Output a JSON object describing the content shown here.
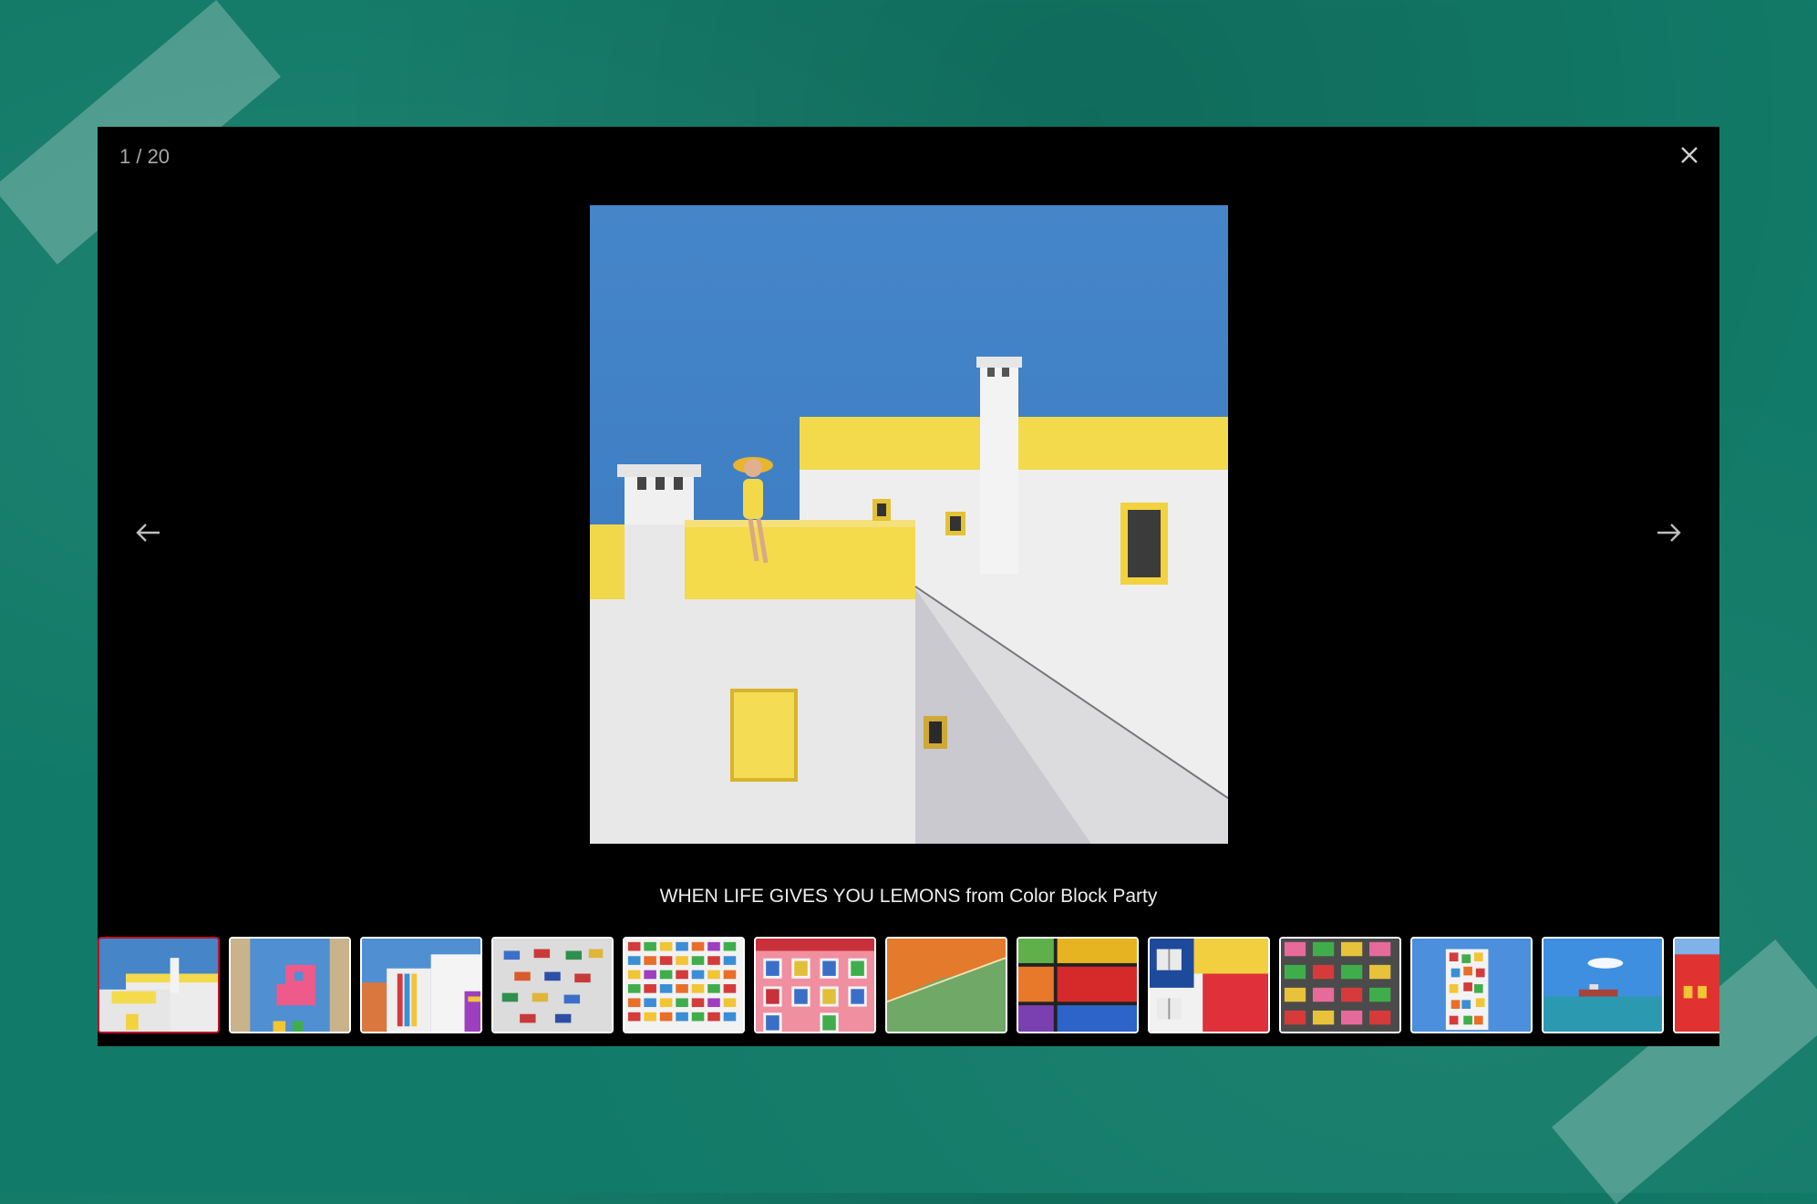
{
  "lightbox": {
    "counter": "1 / 20",
    "caption": "WHEN LIFE GIVES YOU LEMONS from Color Block Party",
    "close_icon": "close-icon",
    "prev_icon": "arrow-left-icon",
    "next_icon": "arrow-right-icon"
  },
  "colors": {
    "background": "#127a68",
    "lightbox_bg": "#000000",
    "active_thumb_border": "#c0102a",
    "sky": "#3f7fc6",
    "yellow": "#f3dc4a"
  },
  "thumbnails": [
    {
      "index": 1,
      "active": true
    },
    {
      "index": 2,
      "active": false
    },
    {
      "index": 3,
      "active": false
    },
    {
      "index": 4,
      "active": false
    },
    {
      "index": 5,
      "active": false
    },
    {
      "index": 6,
      "active": false
    },
    {
      "index": 7,
      "active": false
    },
    {
      "index": 8,
      "active": false
    },
    {
      "index": 9,
      "active": false
    },
    {
      "index": 10,
      "active": false
    },
    {
      "index": 11,
      "active": false
    },
    {
      "index": 12,
      "active": false
    },
    {
      "index": 13,
      "active": false
    }
  ]
}
